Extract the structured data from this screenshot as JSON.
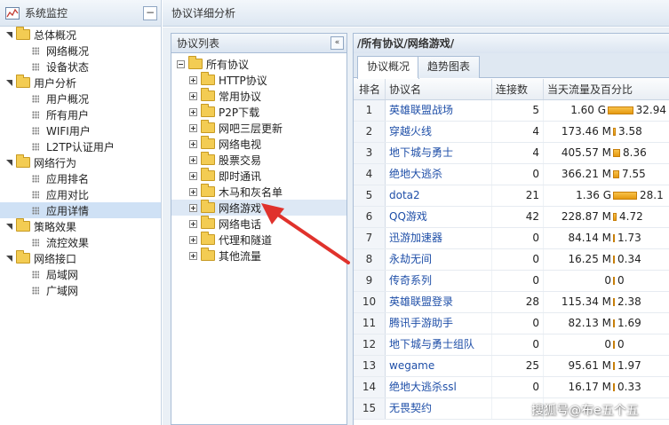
{
  "nav": {
    "title": "系统监控",
    "collapse_label": "−",
    "groups": [
      {
        "label": "总体概况",
        "children": [
          "网络概况",
          "设备状态"
        ]
      },
      {
        "label": "用户分析",
        "children": [
          "用户概况",
          "所有用户",
          "WIFI用户",
          "L2TP认证用户"
        ]
      },
      {
        "label": "网络行为",
        "children": [
          "应用排名",
          "应用对比",
          "应用详情"
        ]
      },
      {
        "label": "策略效果",
        "children": [
          "流控效果"
        ]
      },
      {
        "label": "网络接口",
        "children": [
          "局域网",
          "广域网"
        ]
      }
    ]
  },
  "main": {
    "title": "协议详细分析"
  },
  "protocol_list": {
    "title": "协议列表",
    "collapse_label": "«",
    "root": "所有协议",
    "items": [
      "HTTP协议",
      "常用协议",
      "P2P下载",
      "网吧三层更新",
      "网络电视",
      "股票交易",
      "即时通讯",
      "木马和灰名单",
      "网络游戏",
      "网络电话",
      "代理和隧道",
      "其他流量"
    ],
    "selected_index": 8
  },
  "detail": {
    "breadcrumb": "/所有协议/网络游戏/",
    "tabs": [
      {
        "label": "协议概况",
        "active": true
      },
      {
        "label": "趋势图表",
        "active": false
      }
    ],
    "columns": {
      "rank": "排名",
      "name": "协议名",
      "conn": "连接数",
      "flow": "当天流量及百分比"
    },
    "rows": [
      {
        "rank": "1",
        "name": "英雄联盟战场",
        "conn": "5",
        "flow": "1.60 G",
        "pct": "32.94",
        "pct_value": 32.94
      },
      {
        "rank": "2",
        "name": "穿越火线",
        "conn": "4",
        "flow": "173.46 M",
        "pct": "3.58",
        "pct_value": 3.58
      },
      {
        "rank": "3",
        "name": "地下城与勇士",
        "conn": "4",
        "flow": "405.57 M",
        "pct": "8.36",
        "pct_value": 8.36
      },
      {
        "rank": "4",
        "name": "绝地大逃杀",
        "conn": "0",
        "flow": "366.21 M",
        "pct": "7.55",
        "pct_value": 7.55
      },
      {
        "rank": "5",
        "name": "dota2",
        "conn": "21",
        "flow": "1.36 G",
        "pct": "28.1",
        "pct_value": 28.1
      },
      {
        "rank": "6",
        "name": "QQ游戏",
        "conn": "42",
        "flow": "228.87 M",
        "pct": "4.72",
        "pct_value": 4.72
      },
      {
        "rank": "7",
        "name": "迅游加速器",
        "conn": "0",
        "flow": "84.14 M",
        "pct": "1.73",
        "pct_value": 1.73
      },
      {
        "rank": "8",
        "name": "永劫无间",
        "conn": "0",
        "flow": "16.25 M",
        "pct": "0.34",
        "pct_value": 0.34
      },
      {
        "rank": "9",
        "name": "传奇系列",
        "conn": "0",
        "flow": "0",
        "pct": "0",
        "pct_value": 0
      },
      {
        "rank": "10",
        "name": "英雄联盟登录",
        "conn": "28",
        "flow": "115.34 M",
        "pct": "2.38",
        "pct_value": 2.38
      },
      {
        "rank": "11",
        "name": "腾讯手游助手",
        "conn": "0",
        "flow": "82.13 M",
        "pct": "1.69",
        "pct_value": 1.69
      },
      {
        "rank": "12",
        "name": "地下城与勇士组队",
        "conn": "0",
        "flow": "0",
        "pct": "0",
        "pct_value": 0
      },
      {
        "rank": "13",
        "name": "wegame",
        "conn": "25",
        "flow": "95.61 M",
        "pct": "1.97",
        "pct_value": 1.97
      },
      {
        "rank": "14",
        "name": "绝地大逃杀ssl",
        "conn": "0",
        "flow": "16.17 M",
        "pct": "0.33",
        "pct_value": 0.33
      },
      {
        "rank": "15",
        "name": "无畏契约",
        "conn": "",
        "flow": "",
        "pct": "",
        "pct_value": 0
      }
    ]
  },
  "watermark": "搜狐号@布e五个五",
  "colors": {
    "link": "#1f4fa8",
    "bar": "#f0a623",
    "arrow": "#e0322c",
    "header_bg": "#dde7f2"
  }
}
